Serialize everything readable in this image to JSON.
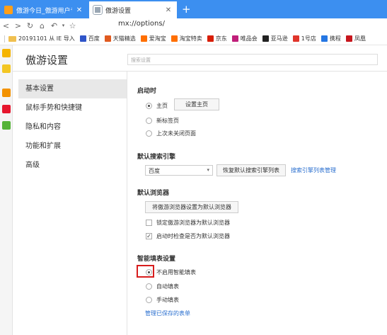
{
  "tabs": [
    {
      "title": "傲游今日_傲游用户专属的",
      "active": false
    },
    {
      "title": "傲游设置",
      "active": true
    }
  ],
  "toolbar": {
    "back": "<",
    "forward": ">",
    "reload": "↻",
    "home": "⌂",
    "undo": "↶",
    "star": "☆",
    "address": "mx://options/"
  },
  "bookmarks": [
    {
      "label": "20191101 从 IE 导入",
      "color": "#f0c050"
    },
    {
      "label": "百度",
      "color": "#2f55c9"
    },
    {
      "label": "天猫精选",
      "color": "#e05a20"
    },
    {
      "label": "爱淘宝",
      "color": "#ff6f00"
    },
    {
      "label": "淘宝特卖",
      "color": "#ff6f00"
    },
    {
      "label": "京东",
      "color": "#d81e06"
    },
    {
      "label": "唯品会",
      "color": "#c01f7a"
    },
    {
      "label": "亚马逊",
      "color": "#222222"
    },
    {
      "label": "1号店",
      "color": "#e0352b"
    },
    {
      "label": "携程",
      "color": "#2577e3"
    },
    {
      "label": "凤凰",
      "color": "#c7161d"
    }
  ],
  "page": {
    "title": "傲游设置",
    "search_placeholder": "搜索设置"
  },
  "nav": [
    {
      "label": "基本设置",
      "active": true
    },
    {
      "label": "鼠标手势和快捷键",
      "active": false
    },
    {
      "label": "隐私和内容",
      "active": false
    },
    {
      "label": "功能和扩展",
      "active": false
    },
    {
      "label": "高级",
      "active": false
    }
  ],
  "startup": {
    "title": "启动时",
    "options": [
      {
        "label": "主页",
        "checked": true
      },
      {
        "label": "新标签页",
        "checked": false
      },
      {
        "label": "上次未关闭页面",
        "checked": false
      }
    ],
    "set_home_button": "设置主页"
  },
  "search_engine": {
    "title": "默认搜索引擎",
    "selected": "百度",
    "restore_button": "恢复默认搜索引擎列表",
    "manage_link": "搜索引擎列表管理"
  },
  "default_browser": {
    "title": "默认浏览器",
    "set_button": "将傲游浏览器设置为默认浏览器",
    "lock_label": "锁定傲游浏览器为默认浏览器",
    "lock_checked": false,
    "check_label": "启动时检查是否为默认浏览器",
    "check_checked": true
  },
  "autofill": {
    "title": "智能填表设置",
    "options": [
      {
        "label": "不启用智能填表",
        "checked": true
      },
      {
        "label": "自动填表",
        "checked": false
      },
      {
        "label": "手动填表",
        "checked": false
      }
    ],
    "manage_link": "管理已保存的表单"
  },
  "colors": {
    "tabstrip": "#3c8ff0",
    "link": "#2a6fcf",
    "highlight": "#d71d1d"
  }
}
